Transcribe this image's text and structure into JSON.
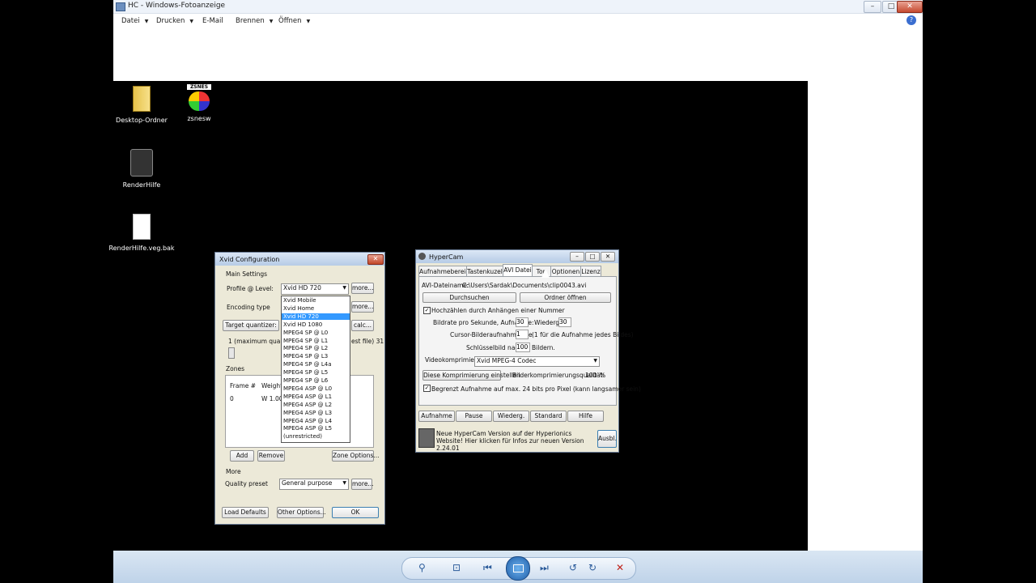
{
  "window": {
    "title": "HC - Windows-Fotoanzeige",
    "controls": {
      "minimize": "–",
      "maximize": "□",
      "close": "✕"
    },
    "help": "?"
  },
  "menubar": [
    {
      "label": "Datei",
      "has_arrow": true
    },
    {
      "label": "Drucken",
      "has_arrow": true
    },
    {
      "label": "E-Mail",
      "has_arrow": false
    },
    {
      "label": "Brennen",
      "has_arrow": true
    },
    {
      "label": "Öffnen",
      "has_arrow": true
    }
  ],
  "desktop": {
    "icons": [
      {
        "label": "Desktop-Ordner",
        "icon": "folder-icon"
      },
      {
        "label": "zsnesw",
        "icon": "zsnes-icon",
        "badge": "ZSNES"
      },
      {
        "label": "RenderHilfe",
        "icon": "app-icon"
      },
      {
        "label": "RenderHilfe.veg.bak",
        "icon": "file-icon"
      }
    ]
  },
  "xvid": {
    "title": "Xvid Configuration",
    "main_settings": "Main Settings",
    "profile_label": "Profile @ Level:",
    "profile_value": "Xvid HD 720",
    "more": "more...",
    "encoding_label": "Encoding type",
    "target_quantizer": "Target quantizer:",
    "calc": "calc...",
    "quality_left": "1 (maximum quality)",
    "quality_right": "est file) 31",
    "zones": "Zones",
    "col_frame": "Frame #",
    "col_weight": "Weight /",
    "row_frame": "0",
    "row_weight": "W 1.00",
    "add": "Add",
    "remove": "Remove",
    "zone_options": "Zone Options...",
    "more_section": "More",
    "quality_preset_label": "Quality preset",
    "quality_preset_value": "General purpose",
    "load_defaults": "Load Defaults",
    "other_options": "Other Options...",
    "ok": "OK",
    "dropdown": [
      "Xvid Mobile",
      "Xvid Home",
      "Xvid HD 720",
      "Xvid HD 1080",
      "MPEG4 SP @ L0",
      "MPEG4 SP @ L1",
      "MPEG4 SP @ L2",
      "MPEG4 SP @ L3",
      "MPEG4 SP @ L4a",
      "MPEG4 SP @ L5",
      "MPEG4 SP @ L6",
      "MPEG4 ASP @ L0",
      "MPEG4 ASP @ L1",
      "MPEG4 ASP @ L2",
      "MPEG4 ASP @ L3",
      "MPEG4 ASP @ L4",
      "MPEG4 ASP @ L5",
      "(unrestricted)"
    ],
    "dropdown_selected": "Xvid HD 720"
  },
  "hypercam": {
    "title": "HyperCam",
    "tabs": [
      "Aufnahmebereich",
      "Tastenkuzel",
      "AVI Datei",
      "Ton",
      "Optionen",
      "Lizenz"
    ],
    "active_tab": "AVI Datei",
    "filename_label": "AVI-Dateiname:",
    "filename_value": "C:\\Users\\Sardak\\Documents\\clip0043.avi",
    "browse": "Durchsuchen",
    "open_folder": "Ordner öffnen",
    "autoincrement": "Hochzählen durch Anhängen einer Nummer",
    "framerate_label": "Bildrate pro Sekunde, Aufnahme:",
    "framerate_value": "30",
    "playback_label": "Wiederg.:",
    "playback_value": "30",
    "cursor_label": "Cursor-Bilderaufnahmerate",
    "cursor_value": "1",
    "cursor_hint": "(1 für die Aufnahme jedes Bildes)",
    "keyframe_label": "Schlüsselbild nach:",
    "keyframe_value": "100",
    "keyframe_unit": "Bildern.",
    "compression_label": "Videokomprimierung:",
    "compression_value": "Xvid MPEG-4 Codec",
    "configure": "Diese Komprimierung einstellen",
    "quality_label": "Bilderkomprimierungsqualität:",
    "quality_value": "100",
    "quality_unit": "%",
    "limit": "Begrenzt Aufnahme auf max. 24 bits pro Pixel (kann langsamer sein)",
    "buttons": [
      "Aufnahme",
      "Pause",
      "Wiederg.",
      "Standard",
      "Hilfe"
    ],
    "news": "Neue HyperCam Version auf der Hyperionics Website! Hier klicken für Infos zur neuen Version 2.24.01",
    "ausbl": "Ausbl."
  },
  "viewer_controls": {
    "zoom": "⚲",
    "fit": "⊡",
    "prev": "⏮",
    "next": "⏭",
    "rotate_left": "↺",
    "rotate_right": "↻",
    "delete": "✕"
  }
}
